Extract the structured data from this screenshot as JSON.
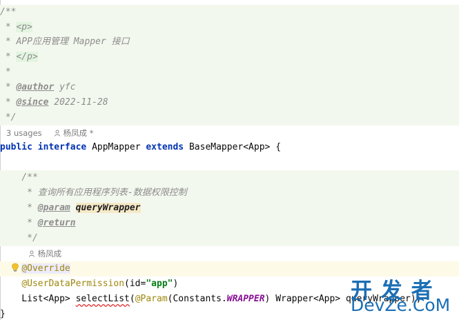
{
  "code": {
    "l1": "/**",
    "l2_prefix": " * ",
    "l2_tag": "<p>",
    "l3": " * APP应用管理 Mapper 接口",
    "l4_prefix": " * ",
    "l4_tag": "</p>",
    "l5": " *",
    "l6_prefix": " * ",
    "l6_tag": "@author",
    "l6_val": " yfc",
    "l7_prefix": " * ",
    "l7_tag": "@since",
    "l7_val": " 2022-11-28",
    "l8": " */",
    "usages": "3 usages",
    "author_hint": "杨凤成 *",
    "iface_kw1": "public",
    "iface_kw2": "interface",
    "iface_name": " AppMapper ",
    "iface_kw3": "extends",
    "iface_rest": " BaseMapper<App> {",
    "m1": "    /**",
    "m2": "     * 查询所有应用程序列表-数据权限控制",
    "m3_prefix": "     * ",
    "m3_tag": "@param",
    "m3_name": "queryWrapper",
    "m4_prefix": "     * ",
    "m4_tag": "@return",
    "m5": "     */",
    "author_hint2": "杨凤成",
    "ov": "@Override",
    "udp_ann": "@UserDataPermission",
    "udp_open": "(id=",
    "udp_str": "\"app\"",
    "udp_close": ")",
    "sig1": "    List<App> ",
    "sig_method": "selectList",
    "sig2": "(",
    "sig_param_ann": "@Param",
    "sig3": "(Constants.",
    "sig_const": "WRAPPER",
    "sig4": ") Wrapper<App> queryWrapper);",
    "closing": "}"
  },
  "watermark": {
    "line1": "开 发 者",
    "line2": "DevZe.CoM"
  },
  "icons": {
    "bulb": "intention-bulb-icon",
    "person": "person-icon"
  }
}
